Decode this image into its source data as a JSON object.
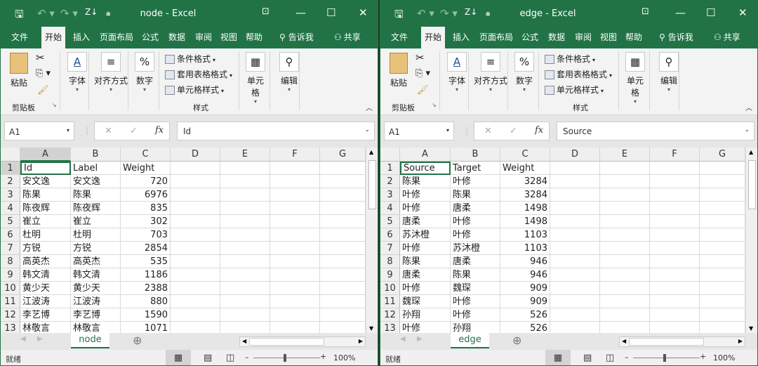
{
  "windows": [
    {
      "title": "node - Excel",
      "tabs": [
        "文件",
        "开始",
        "插入",
        "页面布局",
        "公式",
        "数据",
        "审阅",
        "视图",
        "帮助"
      ],
      "tell_me": "告诉我",
      "share": "共享",
      "ribbon": {
        "paste": "粘贴",
        "clipboard": "剪贴板",
        "font": "字体",
        "align": "对齐方式",
        "number": "数字",
        "cond_format": "条件格式",
        "table_format": "套用表格格式",
        "cell_style": "单元格样式",
        "styles": "样式",
        "cells": "单元格",
        "editing": "编辑"
      },
      "name_box": "A1",
      "formula": "Id",
      "columns": [
        "A",
        "B",
        "C",
        "D",
        "E",
        "F",
        "G"
      ],
      "rows": [
        [
          "Id",
          "Label",
          "Weight"
        ],
        [
          "安文逸",
          "安文逸",
          "720"
        ],
        [
          "陈果",
          "陈果",
          "6976"
        ],
        [
          "陈夜辉",
          "陈夜辉",
          "835"
        ],
        [
          "崔立",
          "崔立",
          "302"
        ],
        [
          "杜明",
          "杜明",
          "703"
        ],
        [
          "方锐",
          "方锐",
          "2854"
        ],
        [
          "高英杰",
          "高英杰",
          "535"
        ],
        [
          "韩文清",
          "韩文清",
          "1186"
        ],
        [
          "黄少天",
          "黄少天",
          "2388"
        ],
        [
          "江波涛",
          "江波涛",
          "880"
        ],
        [
          "李艺博",
          "李艺博",
          "1590"
        ],
        [
          "林敬言",
          "林敬言",
          "1071"
        ]
      ],
      "sheet_tab": "node",
      "status": "就绪",
      "zoom": "100%",
      "selected_row": 1
    },
    {
      "title": "edge - Excel",
      "tabs": [
        "文件",
        "开始",
        "插入",
        "页面布局",
        "公式",
        "数据",
        "审阅",
        "视图",
        "帮助"
      ],
      "tell_me": "告诉我",
      "share": "共享",
      "ribbon": {
        "paste": "粘贴",
        "clipboard": "剪贴板",
        "font": "字体",
        "align": "对齐方式",
        "number": "数字",
        "cond_format": "条件格式",
        "table_format": "套用表格格式",
        "cell_style": "单元格样式",
        "styles": "样式",
        "cells": "单元格",
        "editing": "编辑"
      },
      "name_box": "A1",
      "formula": "Source",
      "columns": [
        "A",
        "B",
        "C",
        "D",
        "E",
        "F",
        "G"
      ],
      "rows": [
        [
          "Source",
          "Target",
          "Weight"
        ],
        [
          "陈果",
          "叶修",
          "3284"
        ],
        [
          "叶修",
          "陈果",
          "3284"
        ],
        [
          "叶修",
          "唐柔",
          "1498"
        ],
        [
          "唐柔",
          "叶修",
          "1498"
        ],
        [
          "苏沐橙",
          "叶修",
          "1103"
        ],
        [
          "叶修",
          "苏沐橙",
          "1103"
        ],
        [
          "陈果",
          "唐柔",
          "946"
        ],
        [
          "唐柔",
          "陈果",
          "946"
        ],
        [
          "叶修",
          "魏琛",
          "909"
        ],
        [
          "魏琛",
          "叶修",
          "909"
        ],
        [
          "孙翔",
          "叶修",
          "526"
        ],
        [
          "叶修",
          "孙翔",
          "526"
        ]
      ],
      "sheet_tab": "edge",
      "status": "就绪",
      "zoom": "100%",
      "selected_row": 0
    }
  ],
  "colors": {
    "accent": "#217346"
  }
}
